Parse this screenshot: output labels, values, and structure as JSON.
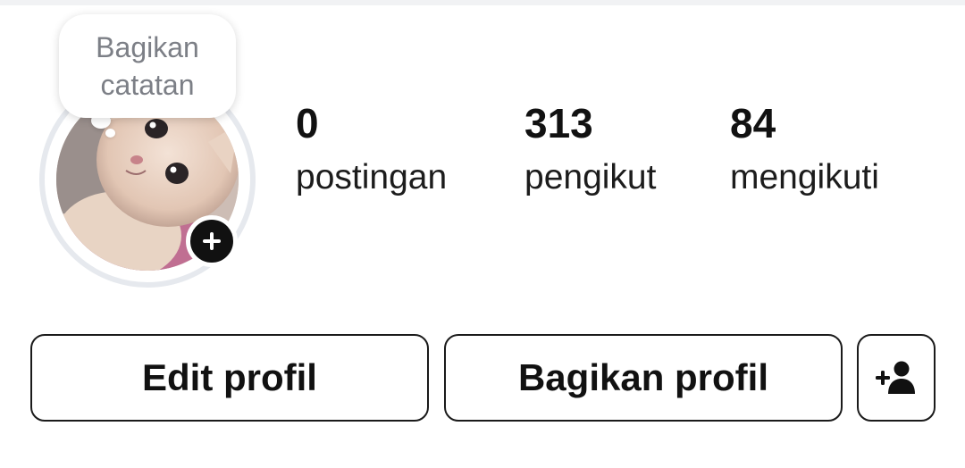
{
  "note": {
    "placeholder_line1": "Bagikan",
    "placeholder_line2": "catatan"
  },
  "avatar": {
    "add_story_icon": "plus-icon"
  },
  "stats": {
    "posts": {
      "count": "0",
      "label": "postingan"
    },
    "followers": {
      "count": "313",
      "label": "pengikut"
    },
    "following": {
      "count": "84",
      "label": "mengikuti"
    }
  },
  "actions": {
    "edit_profile_label": "Edit profil",
    "share_profile_label": "Bagikan profil",
    "discover_people_icon": "add-person-icon"
  }
}
